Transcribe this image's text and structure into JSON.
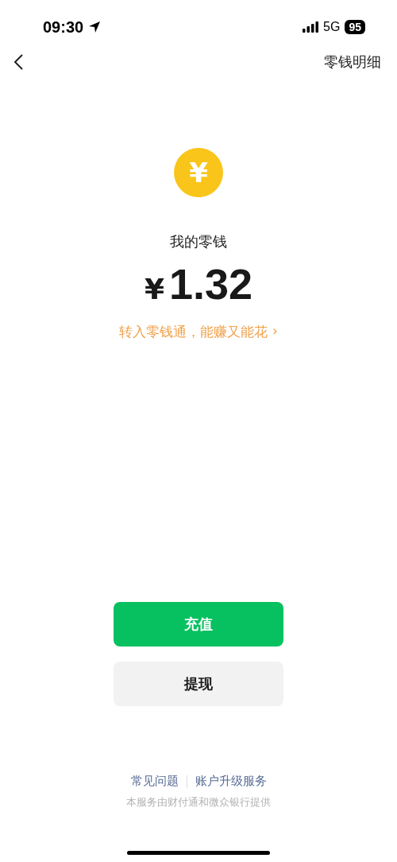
{
  "status_bar": {
    "time": "09:30",
    "network": "5G",
    "battery": "95"
  },
  "nav": {
    "title": "零钱明细"
  },
  "balance": {
    "coin_symbol": "¥",
    "label": "我的零钱",
    "currency": "¥",
    "amount": "1.32",
    "promo": "转入零钱通，能赚又能花",
    "promo_arrow": "›"
  },
  "buttons": [
    {
      "label": "充值",
      "kind": "primary"
    },
    {
      "label": "提现",
      "kind": "secondary"
    }
  ],
  "footer": {
    "links": [
      "常见问题",
      "账户升级服务"
    ],
    "note": "本服务由财付通和微众银行提供"
  }
}
